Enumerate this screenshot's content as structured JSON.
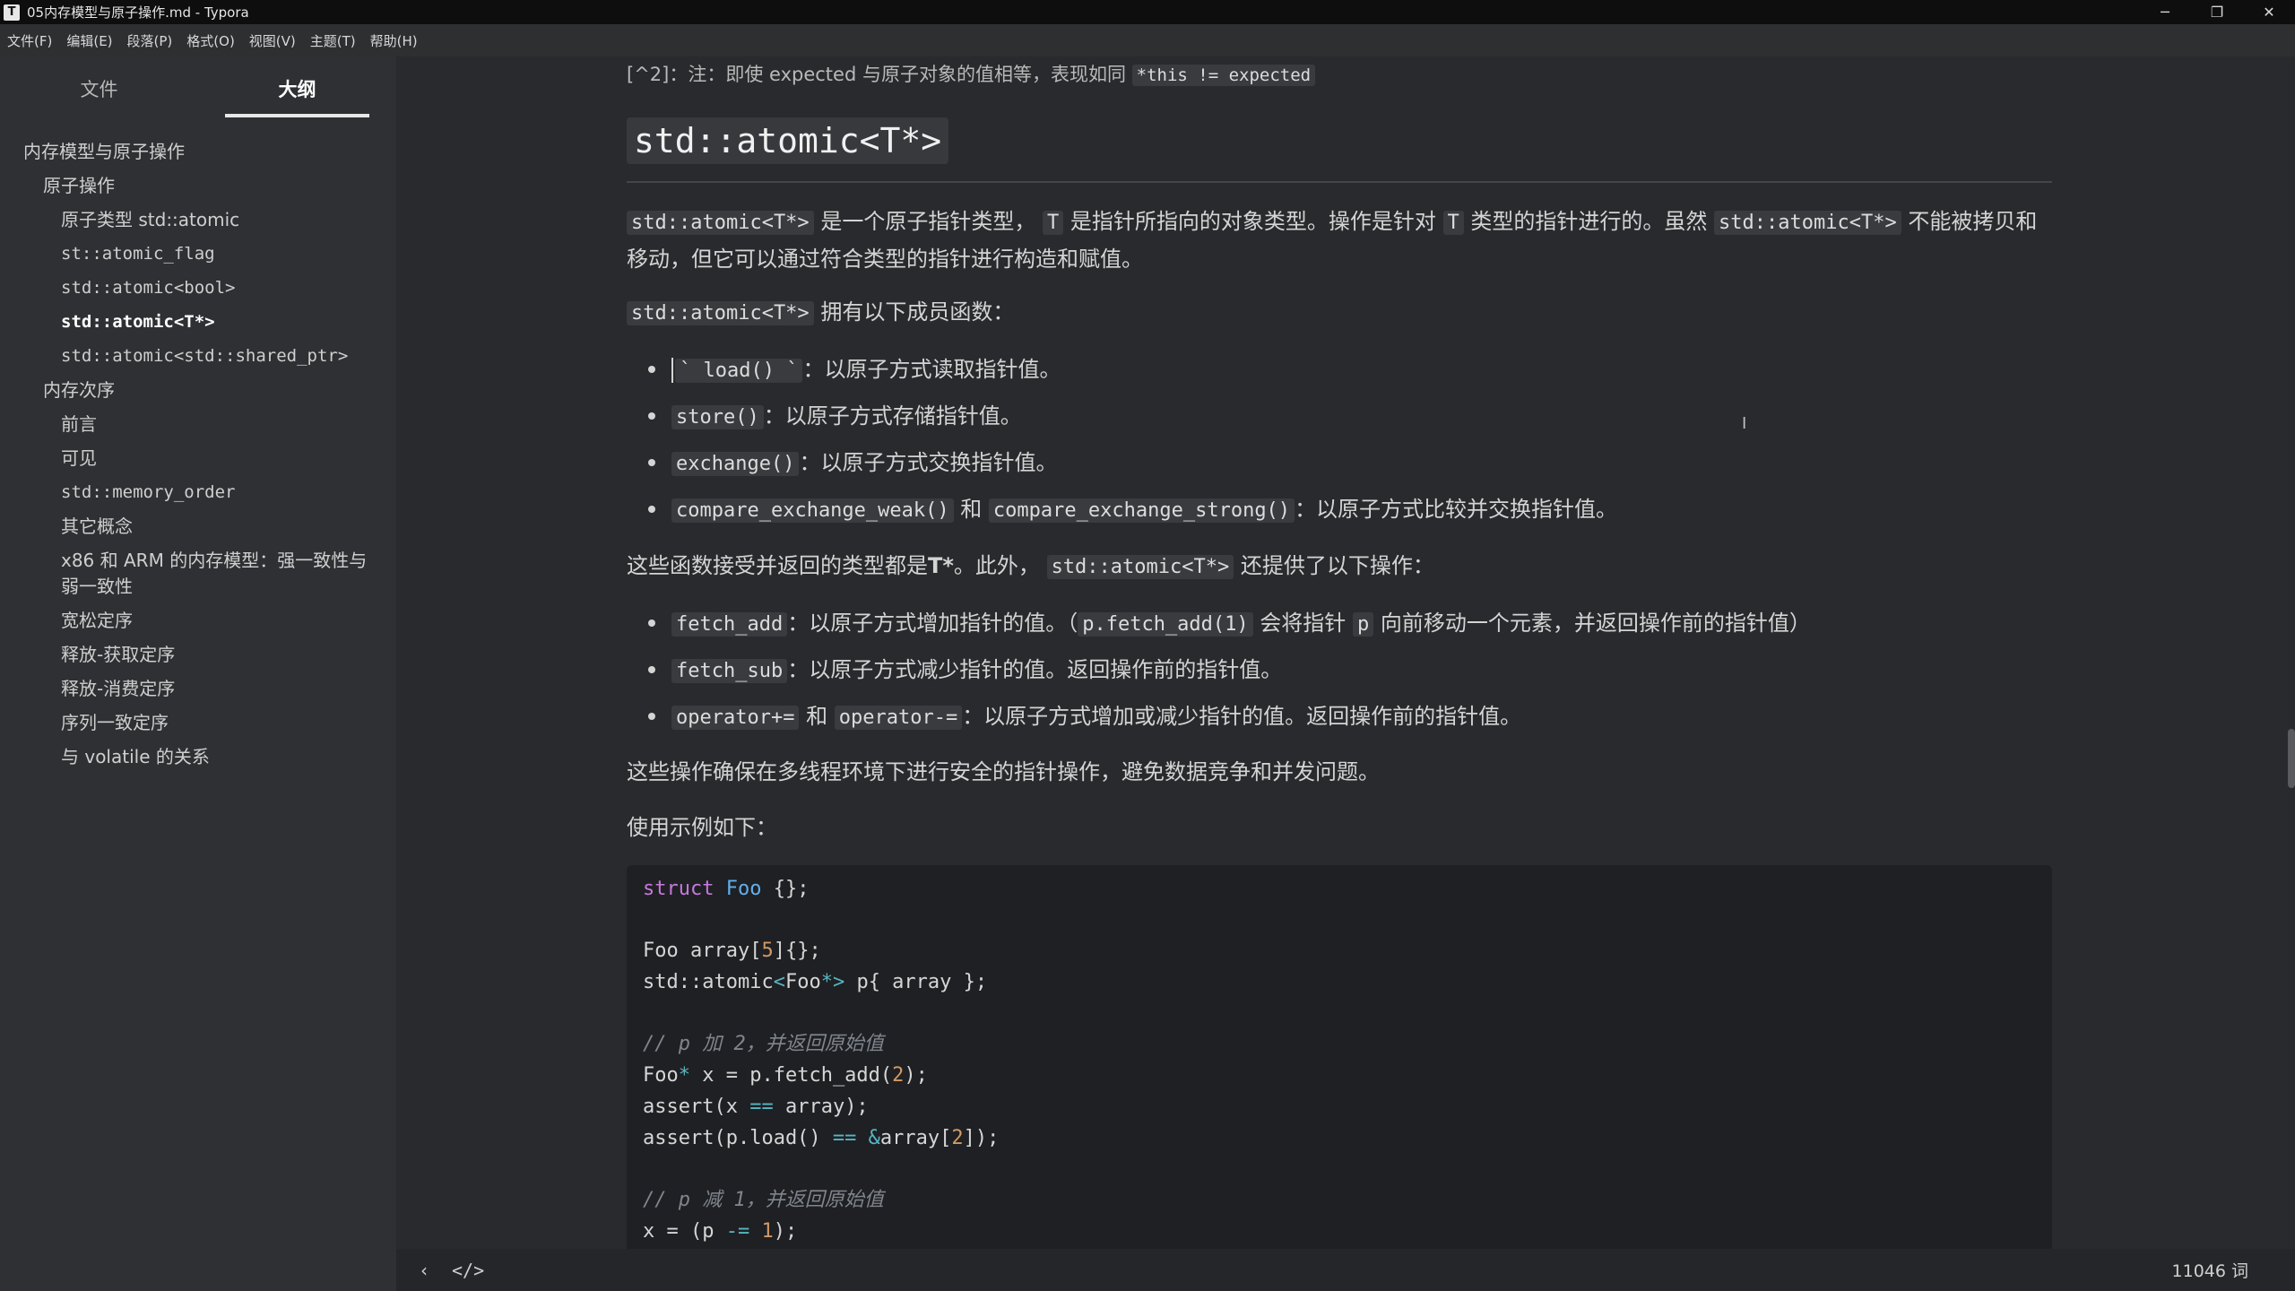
{
  "window": {
    "app_icon": "T",
    "title": "05内存模型与原子操作.md - Typora",
    "minimize": "─",
    "maximize": "❐",
    "close": "✕"
  },
  "menu": [
    "文件(F)",
    "编辑(E)",
    "段落(P)",
    "格式(O)",
    "视图(V)",
    "主题(T)",
    "帮助(H)"
  ],
  "sidebar": {
    "tabs": [
      "文件",
      "大纲"
    ],
    "active_tab": "大纲",
    "outline": [
      {
        "text": "内存模型与原子操作",
        "level": 1,
        "code": false
      },
      {
        "text": "原子操作",
        "level": 2,
        "code": false
      },
      {
        "text": "原子类型 std::atomic",
        "level": 3,
        "code": false
      },
      {
        "text": "st::atomic_flag",
        "level": 3,
        "code": true
      },
      {
        "text": "std::atomic<bool>",
        "level": 3,
        "code": true
      },
      {
        "text": "std::atomic<T*>",
        "level": 3,
        "code": true,
        "active": true
      },
      {
        "text": "std::atomic<std::shared_ptr>",
        "level": 3,
        "code": true
      },
      {
        "text": "内存次序",
        "level": 2,
        "code": false
      },
      {
        "text": "前言",
        "level": 3,
        "code": false
      },
      {
        "text": "可见",
        "level": 3,
        "code": false
      },
      {
        "text": "std::memory_order",
        "level": 3,
        "code": true
      },
      {
        "text": "其它概念",
        "level": 3,
        "code": false
      },
      {
        "text": "x86 和 ARM 的内存模型：强一致性与弱一致性",
        "level": 3,
        "code": false
      },
      {
        "text": "宽松定序",
        "level": 3,
        "code": false
      },
      {
        "text": "释放-获取定序",
        "level": 3,
        "code": false
      },
      {
        "text": "释放-消费定序",
        "level": 3,
        "code": false
      },
      {
        "text": "序列一致定序",
        "level": 3,
        "code": false
      },
      {
        "text": "与 volatile 的关系",
        "level": 3,
        "code": false
      }
    ]
  },
  "doc": {
    "footnote_prefix": "[^2]：注：即使 expected 与原子对象的值相等，表现如同",
    "footnote_code": "*this != expected",
    "heading": "std::atomic<T*>",
    "p1_code1": "std::atomic<T*>",
    "p1_text1": "是一个原子指针类型，",
    "p1_code2": "T",
    "p1_text2": "是指针所指向的对象类型。操作是针对",
    "p1_code3": "T",
    "p1_text3": "类型的指针进行的。虽然",
    "p1_code4": "std::atomic<T*>",
    "p1_text4": "不能被拷贝和移动，但它可以通过符合类型的指针进行构造和赋值。",
    "p2_code": "std::atomic<T*>",
    "p2_text": "拥有以下成员函数：",
    "members": [
      {
        "code": "` load() `",
        "text": "：以原子方式读取指针值。"
      },
      {
        "code": "store()",
        "text": "：以原子方式存储指针值。"
      },
      {
        "code": "exchange()",
        "text": "：以原子方式交换指针值。"
      },
      {
        "code": "compare_exchange_weak()",
        "mid": "和",
        "code2": "compare_exchange_strong()",
        "text": "：以原子方式比较并交换指针值。"
      }
    ],
    "p3_text1": "这些函数接受并返回的类型都是",
    "p3_bold": "T*",
    "p3_text2": "。此外，",
    "p3_code": "std::atomic<T*>",
    "p3_text3": "还提供了以下操作：",
    "ops": [
      {
        "code": "fetch_add",
        "text": "：以原子方式增加指针的值。（",
        "code2": "p.fetch_add(1)",
        "text2": "会将指针",
        "code3": "p",
        "text3": "向前移动一个元素，并返回操作前的指针值）"
      },
      {
        "code": "fetch_sub",
        "text": "：以原子方式减少指针的值。返回操作前的指针值。"
      },
      {
        "code": "operator+=",
        "mid": "和",
        "code2": "operator-=",
        "text": "：以原子方式增加或减少指针的值。返回操作前的指针值。"
      }
    ],
    "p4": "这些操作确保在多线程环境下进行安全的指针操作，避免数据竞争和并发问题。",
    "p5": "使用示例如下：",
    "code_lines": [
      "struct Foo {};",
      "",
      "Foo array[5]{};",
      "std::atomic<Foo*> p{ array };",
      "",
      "// p 加 2，并返回原始值",
      "Foo* x = p.fetch_add(2);",
      "assert(x == array);",
      "assert(p.load() == &array[2]);",
      "",
      "// p 减 1，并返回原始值",
      "x = (p -= 1);"
    ]
  },
  "status": {
    "back": "‹",
    "source": "</>",
    "word_count": "11046 词"
  }
}
